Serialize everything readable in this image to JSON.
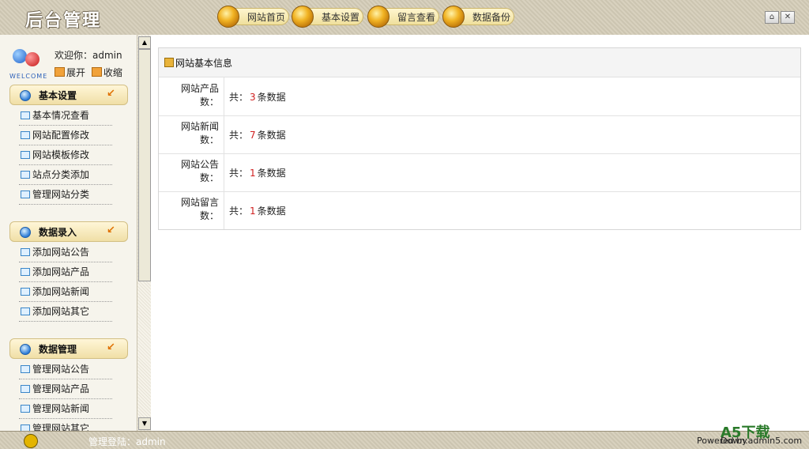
{
  "header": {
    "logo": "后台管理",
    "nav": [
      "网站首页",
      "基本设置",
      "留言查看",
      "数据备份"
    ],
    "window_buttons": [
      "⌂",
      "✕"
    ]
  },
  "sidebar": {
    "welcome_text": "欢迎你：admin",
    "expand": "展开",
    "collapse": "收缩",
    "sections": [
      {
        "title": "基本设置",
        "items": [
          "基本情况查看",
          "网站配置修改",
          "网站模板修改",
          "站点分类添加",
          "管理网站分类"
        ]
      },
      {
        "title": "数据录入",
        "items": [
          "添加网站公告",
          "添加网站产品",
          "添加网站新闻",
          "添加网站其它"
        ]
      },
      {
        "title": "数据管理",
        "items": [
          "管理网站公告",
          "管理网站产品",
          "管理网站新闻",
          "管理网站其它"
        ]
      }
    ]
  },
  "main": {
    "panel_title": "网站基本信息",
    "rows": [
      {
        "label": "网站产品数：",
        "prefix": "共：",
        "count": "3",
        "suffix": "条数据"
      },
      {
        "label": "网站新闻数：",
        "prefix": "共：",
        "count": "7",
        "suffix": "条数据"
      },
      {
        "label": "网站公告数：",
        "prefix": "共：",
        "count": "1",
        "suffix": "条数据"
      },
      {
        "label": "网站留言数：",
        "prefix": "共：",
        "count": "1",
        "suffix": "条数据"
      }
    ]
  },
  "footer": {
    "login_text": "管理登陆：admin",
    "powered": "Powered by",
    "watermark": "A5下载",
    "watermark_url": "Down.admin5.com"
  }
}
